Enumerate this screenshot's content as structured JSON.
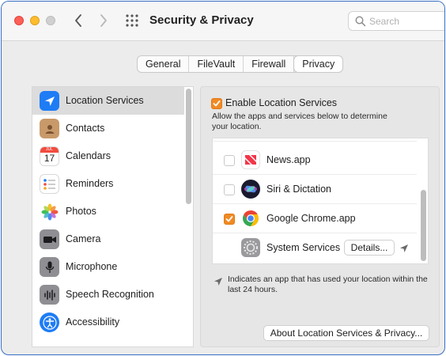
{
  "window": {
    "title": "Security & Privacy"
  },
  "search": {
    "placeholder": "Search"
  },
  "tabs": [
    {
      "label": "General"
    },
    {
      "label": "FileVault"
    },
    {
      "label": "Firewall"
    },
    {
      "label": "Privacy",
      "active": true
    }
  ],
  "sidebar": {
    "items": [
      {
        "label": "Location Services",
        "icon": "location-arrow-icon",
        "selected": true
      },
      {
        "label": "Contacts",
        "icon": "contacts-icon"
      },
      {
        "label": "Calendars",
        "icon": "calendar-icon",
        "icon_text": "17",
        "icon_month": "JUL"
      },
      {
        "label": "Reminders",
        "icon": "reminders-icon"
      },
      {
        "label": "Photos",
        "icon": "photos-icon"
      },
      {
        "label": "Camera",
        "icon": "camera-icon"
      },
      {
        "label": "Microphone",
        "icon": "microphone-icon"
      },
      {
        "label": "Speech Recognition",
        "icon": "speech-recognition-icon"
      },
      {
        "label": "Accessibility",
        "icon": "accessibility-icon"
      }
    ]
  },
  "panel": {
    "enable_label": "Enable Location Services",
    "enable_checked": true,
    "description": "Allow the apps and services below to determine your location.",
    "apps": [
      {
        "label": "News.app",
        "checked": false,
        "icon": "news-app-icon"
      },
      {
        "label": "Siri & Dictation",
        "checked": false,
        "icon": "siri-icon"
      },
      {
        "label": "Google Chrome.app",
        "checked": true,
        "icon": "chrome-icon"
      },
      {
        "label": "System Services",
        "icon": "system-services-icon",
        "details_label": "Details..."
      }
    ],
    "legend_text": "Indicates an app that has used your location within the last 24 hours.",
    "about_button": "About Location Services & Privacy..."
  },
  "colors": {
    "accent_orange": "#f08a24",
    "selection_gray": "#dcdcdc",
    "location_blue": "#1e7cf5"
  }
}
